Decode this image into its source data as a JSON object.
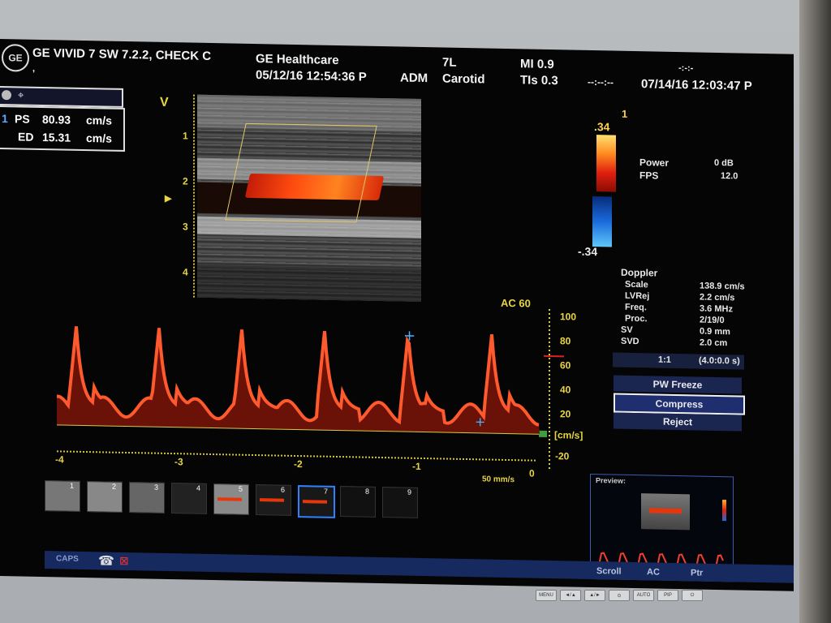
{
  "header": {
    "device": "GE VIVID 7 SW 7.2.2, CHECK C",
    "institution": "GE Healthcare",
    "comma": ",",
    "exam_datetime": "05/12/16 12:54:36 P",
    "operator": "ADM",
    "probe": "7L",
    "application": "Carotid",
    "mi": "MI 0.9",
    "tis": "TIs 0.3",
    "time_placeholder": "--:--:--",
    "top_right_placeholder": "-:-:-",
    "system_datetime": "07/14/16 12:03:47 P",
    "logo": "GE"
  },
  "measurements": {
    "index": "1",
    "ps_label": "PS",
    "ps_value": "80.93",
    "ps_unit": "cm/s",
    "ed_label": "ED",
    "ed_value": "15.31",
    "ed_unit": "cm/s"
  },
  "bmode": {
    "orientation": "V",
    "depth_ticks": [
      "1",
      "2",
      "3",
      "4"
    ]
  },
  "color_scale": {
    "top": ".34",
    "bottom": "-.34",
    "marker": "1",
    "colors": [
      "#ffe070",
      "#ff8a20",
      "#e02010",
      "#1a6bdc",
      "#5ec7f8"
    ]
  },
  "power": {
    "label": "Power",
    "value": "0 dB",
    "fps_label": "FPS",
    "fps_value": "12.0"
  },
  "doppler": {
    "title": "Doppler",
    "rows": [
      {
        "label": "Scale",
        "value": "138.9 cm/s"
      },
      {
        "label": "LVRej",
        "value": "2.2 cm/s"
      },
      {
        "label": "Freq.",
        "value": "3.6 MHz"
      },
      {
        "label": "Proc.",
        "value": "2/19/0"
      },
      {
        "label": "SV",
        "value": "0.9 mm"
      },
      {
        "label": "SVD",
        "value": "2.0 cm"
      }
    ],
    "ratio": "1:1",
    "ratio_detail": "(4.0:0.0 s)"
  },
  "buttons": {
    "pw_freeze": "PW Freeze",
    "compress": "Compress",
    "reject": "Reject"
  },
  "spectral": {
    "ac_label": "AC 60",
    "y_ticks": [
      "100",
      "80",
      "60",
      "40",
      "20",
      "-20"
    ],
    "unit": "[cm/s]",
    "x_ticks": [
      "-4",
      "-3",
      "-2",
      "-1",
      "0"
    ],
    "sweep": "50 mm/s",
    "peak_velocity_cm_s": 80.93,
    "end_diastolic_velocity_cm_s": 15.31
  },
  "thumbnails": [
    {
      "index": "1"
    },
    {
      "index": "2"
    },
    {
      "index": "3"
    },
    {
      "index": "4"
    },
    {
      "index": "5"
    },
    {
      "index": "6"
    },
    {
      "index": "7"
    },
    {
      "index": "8"
    },
    {
      "index": "9"
    }
  ],
  "preview": {
    "label": "Preview:"
  },
  "status": {
    "caps": "CAPS",
    "scroll": "Scroll",
    "ac": "AC",
    "ptr": "Ptr"
  },
  "monitor_buttons": [
    "MENU",
    "◄/▲",
    "▲/►",
    "⊙",
    "AUTO",
    "PIP",
    "⏻"
  ]
}
